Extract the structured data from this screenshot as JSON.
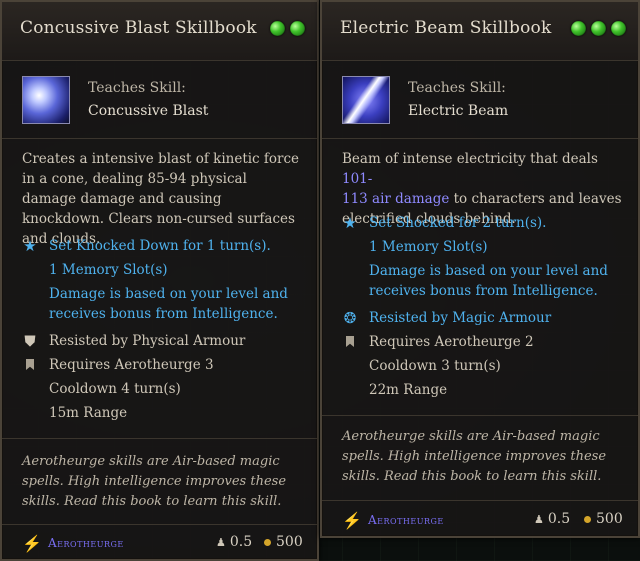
{
  "left": {
    "title": "Concussive Blast Skillbook",
    "gems": 2,
    "teaches_label": "Teaches Skill:",
    "skill_name": "Concussive Blast",
    "description": "Creates a intensive blast of kinetic force in a cone, dealing 85-94 physical damage damage and causing knockdown. Clears non-cursed surfaces and clouds.",
    "status_effect": "Set Knocked Down for 1 turn(s).",
    "memory": "1 Memory Slot(s)",
    "scaling": "Damage is based on your level and receives bonus from Intelligence.",
    "resisted_by": "Resisted by Physical Armour",
    "requires": "Requires Aerotheurge 3",
    "cooldown": "Cooldown  4 turn(s)",
    "range": "15m Range",
    "flavor": "Aerotheurge skills are Air-based magic spells. High intelligence improves these skills. Read this book to learn this skill.",
    "school": "Aerotheurge",
    "weight": "0.5",
    "value": "500"
  },
  "right": {
    "title": "Electric Beam Skillbook",
    "gems": 3,
    "teaches_label": "Teaches Skill:",
    "skill_name": "Electric Beam",
    "desc_pre": "Beam of intense electricity that deals ",
    "desc_dmg1": "101-",
    "desc_dmg2": "113 air damage",
    "desc_post": " to characters and leaves electrified clouds behind.",
    "status_effect": "Set Shocked for 2 turn(s).",
    "memory": "1 Memory Slot(s)",
    "scaling": "Damage is based on your level and receives bonus from Intelligence.",
    "resisted_by": "Resisted by Magic Armour",
    "requires": "Requires Aerotheurge 2",
    "cooldown": "Cooldown  3 turn(s)",
    "range": "22m Range",
    "flavor": "Aerotheurge skills are Air-based magic spells. High intelligence improves these skills. Read this book to learn this skill.",
    "school": "Aerotheurge",
    "weight": "0.5",
    "value": "500"
  },
  "icons": {
    "gem": "green-gem-icon",
    "star": "star-icon",
    "shield": "shield-icon",
    "magic_shield": "magic-shield-icon",
    "bookmark": "bookmark-icon",
    "school": "lightning-icon",
    "weight": "weight-icon",
    "coin": "gold-coin-icon"
  },
  "colors": {
    "title": "#e3dccd",
    "blue_text": "#4fb2ee",
    "damage_text": "#8f8aff",
    "school_text": "#7a6ff5",
    "gem": "#3fc22a",
    "coin": "#d4a52a"
  }
}
